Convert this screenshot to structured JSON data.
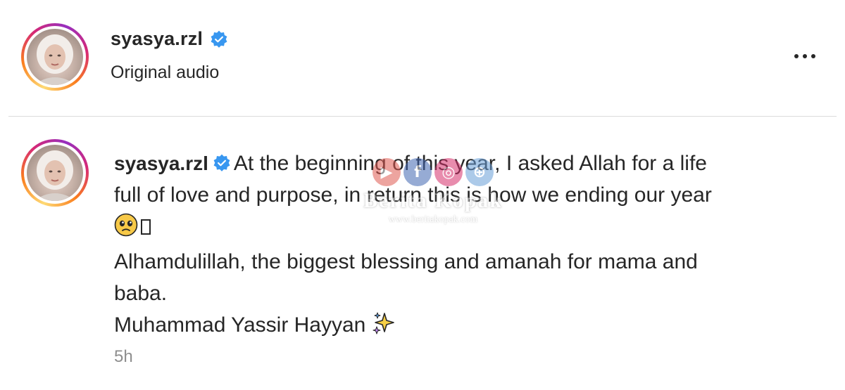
{
  "header": {
    "username": "syasya.rzl",
    "subtitle": "Original audio",
    "verified": true,
    "more_icon": "more-horizontal-icon"
  },
  "caption": {
    "username": "syasya.rzl",
    "line1": "At the beginning of this year, I asked Allah for a life",
    "line2": "full of love and purpose, in return this is how we ending our year",
    "line4": "Alhamdulillah, the biggest blessing and amanah for mama and",
    "line5": "baba.",
    "line6": "Muhammad Yassir Hayyan",
    "emoji_1": "pleading-face-emoji",
    "emoji_2": "sparkles-emoji"
  },
  "timestamp": "5h",
  "watermark": {
    "title": "Berita Kopak",
    "url": "www.beritakopak.com"
  },
  "colors": {
    "verified_blue": "#3897f0",
    "text": "#262626",
    "muted": "#8e8e8e",
    "divider": "#dbdbdb"
  }
}
